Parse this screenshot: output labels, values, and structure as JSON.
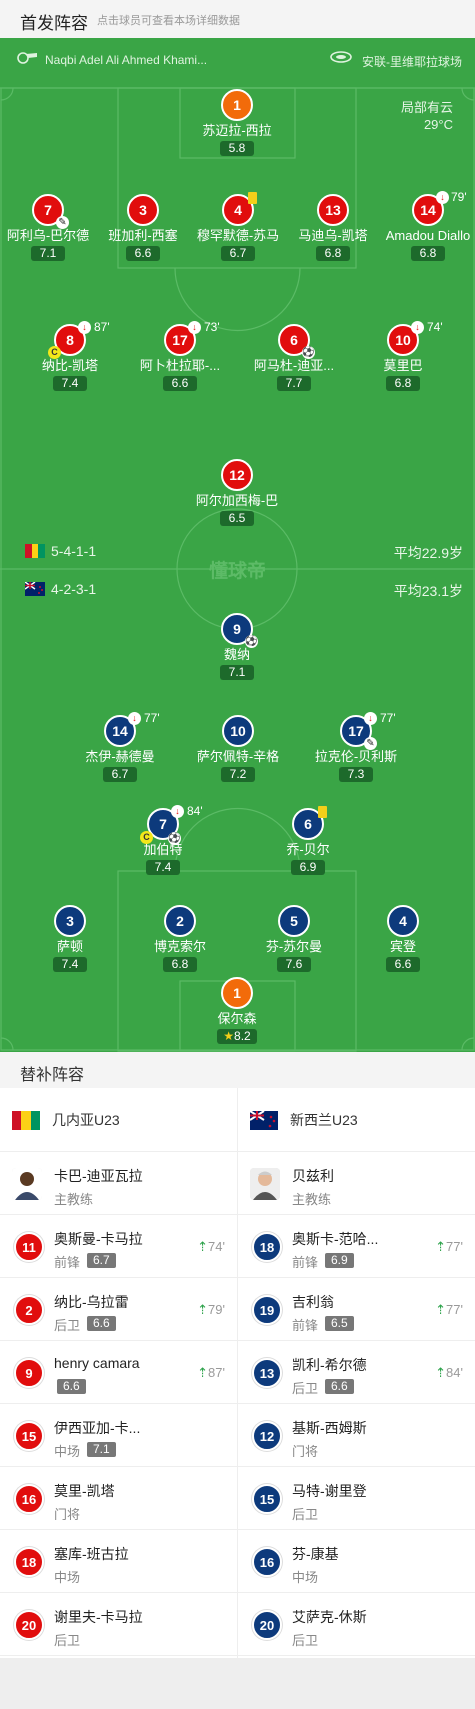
{
  "header": {
    "title": "首发阵容",
    "subtitle": "点击球员可查看本场详细数据"
  },
  "pitch": {
    "referee": "Naqbi Adel Ali Ahmed Khami...",
    "venue": "安联-里维耶拉球场",
    "weather": "局部有云",
    "temperature": "29°C",
    "watermark": "懂球帝",
    "home_formation": "5-4-1-1",
    "home_avg_age": "平均22.9岁",
    "away_formation": "4-2-3-1",
    "away_avg_age": "平均23.1岁"
  },
  "home_players": [
    {
      "num": "1",
      "name": "苏迈拉-西拉",
      "rating": "5.8"
    },
    {
      "num": "7",
      "name": "阿利乌-巴尔德",
      "rating": "7.1"
    },
    {
      "num": "3",
      "name": "班加利-西塞",
      "rating": "6.6"
    },
    {
      "num": "4",
      "name": "穆罕默德-苏马",
      "rating": "6.7"
    },
    {
      "num": "13",
      "name": "马迪乌-凯塔",
      "rating": "6.8"
    },
    {
      "num": "14",
      "name": "Amadou Diallo",
      "rating": "6.8",
      "sub_min": "79'"
    },
    {
      "num": "8",
      "name": "纳比-凯塔",
      "rating": "7.4",
      "sub_min": "87'"
    },
    {
      "num": "17",
      "name": "阿卜杜拉耶-...",
      "rating": "6.6",
      "sub_min": "73'"
    },
    {
      "num": "6",
      "name": "阿马杜-迪亚...",
      "rating": "7.7"
    },
    {
      "num": "10",
      "name": "莫里巴",
      "rating": "6.8",
      "sub_min": "74'"
    },
    {
      "num": "12",
      "name": "阿尔加西梅-巴",
      "rating": "6.5"
    }
  ],
  "away_players": [
    {
      "num": "9",
      "name": "魏纳",
      "rating": "7.1"
    },
    {
      "num": "14",
      "name": "杰伊-赫德曼",
      "rating": "6.7",
      "sub_min": "77'"
    },
    {
      "num": "10",
      "name": "萨尔佩特-辛格",
      "rating": "7.2"
    },
    {
      "num": "17",
      "name": "拉克伦-贝利斯",
      "rating": "7.3",
      "sub_min": "77'"
    },
    {
      "num": "7",
      "name": "加伯特",
      "rating": "7.4",
      "sub_min": "84'"
    },
    {
      "num": "6",
      "name": "乔-贝尔",
      "rating": "6.9"
    },
    {
      "num": "3",
      "name": "萨顿",
      "rating": "7.4"
    },
    {
      "num": "2",
      "name": "博克索尔",
      "rating": "6.8"
    },
    {
      "num": "5",
      "name": "芬-苏尔曼",
      "rating": "7.6"
    },
    {
      "num": "4",
      "name": "宾登",
      "rating": "6.6"
    },
    {
      "num": "1",
      "name": "保尔森",
      "rating": "8.2"
    }
  ],
  "subs": {
    "title": "替补阵容",
    "home_team": "几内亚U23",
    "away_team": "新西兰U23",
    "home_coach": {
      "name": "卡巴-迪亚瓦拉",
      "role": "主教练"
    },
    "away_coach": {
      "name": "贝兹利",
      "role": "主教练"
    },
    "home": [
      {
        "num": "11",
        "name": "奥斯曼-卡马拉",
        "pos": "前锋",
        "rating": "6.7",
        "in": "74'"
      },
      {
        "num": "2",
        "name": "纳比-乌拉雷",
        "pos": "后卫",
        "rating": "6.6",
        "in": "79'"
      },
      {
        "num": "9",
        "name": "henry camara",
        "pos": "",
        "rating": "6.6",
        "in": "87'"
      },
      {
        "num": "15",
        "name": "伊西亚加-卡...",
        "pos": "中场",
        "rating": "7.1"
      },
      {
        "num": "16",
        "name": "莫里-凯塔",
        "pos": "门将"
      },
      {
        "num": "18",
        "name": "塞库-班古拉",
        "pos": "中场"
      },
      {
        "num": "20",
        "name": "谢里夫-卡马拉",
        "pos": "后卫"
      }
    ],
    "away": [
      {
        "num": "18",
        "name": "奥斯卡-范哈...",
        "pos": "前锋",
        "rating": "6.9",
        "in": "77'"
      },
      {
        "num": "19",
        "name": "吉利翁",
        "pos": "前锋",
        "rating": "6.5",
        "in": "77'"
      },
      {
        "num": "13",
        "name": "凯利-希尔德",
        "pos": "后卫",
        "rating": "6.6",
        "in": "84'"
      },
      {
        "num": "12",
        "name": "基斯-西姆斯",
        "pos": "门将"
      },
      {
        "num": "15",
        "name": "马特-谢里登",
        "pos": "后卫"
      },
      {
        "num": "16",
        "name": "芬-康基",
        "pos": "中场"
      },
      {
        "num": "20",
        "name": "艾萨克-休斯",
        "pos": "后卫"
      }
    ]
  },
  "colors": {
    "pitch": "#3aa546",
    "home": "#e10d0d",
    "home_gk": "#f26b0a",
    "away": "#0d3a7c",
    "sub_in": "#2ca24a"
  },
  "icons": [
    "whistle-icon",
    "stadium-icon",
    "sub-out-icon",
    "sub-in-icon",
    "yellow-card-icon",
    "captain-icon",
    "ball-icon",
    "star-icon",
    "guinea-flag-icon",
    "new-zealand-flag-icon"
  ]
}
